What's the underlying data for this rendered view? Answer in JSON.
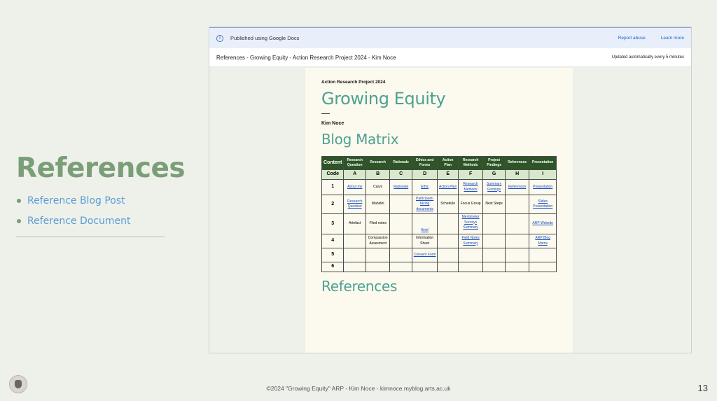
{
  "slide": {
    "title": "References",
    "links": [
      "Reference Blog Post",
      "Reference Document"
    ],
    "footer": "©2024 \"Growing Equity\" ARP - Kim Noce - kimnoce.myblog.arts.ac.uk",
    "page_number": "13"
  },
  "google_bar": {
    "published": "Published using Google Docs",
    "report_abuse": "Report abuse",
    "learn_more": "Learn more"
  },
  "doc_bar": {
    "title": "References - Growing Equity - Action Research Project 2024 - Kim Noce",
    "updated": "Updated automatically every 5 minutes"
  },
  "doc": {
    "project": "Action Research Project 2024",
    "title": "Growing Equity",
    "author": "Kim Noce",
    "matrix_heading": "Blog Matrix",
    "references_heading": "References"
  },
  "matrix": {
    "headers": [
      "Content",
      "Research Question",
      "Research",
      "Rationale",
      "Ethics and Forms",
      "Action Plan",
      "Research Methods",
      "Project Findings",
      "References",
      "Presentation"
    ],
    "codes": [
      "Code",
      "A",
      "B",
      "C",
      "D",
      "E",
      "F",
      "G",
      "H",
      "I"
    ],
    "rows": [
      {
        "num": "1",
        "a": "About me",
        "b": "Carys",
        "c": "Rationale",
        "d": "Ethic",
        "e": "Action Plan",
        "f": "Research Methods",
        "g": "Summary Findings",
        "h": "References",
        "i": "Presentation"
      },
      {
        "num": "2",
        "a": "Research Question",
        "b": "Mahidol",
        "d": "Participant-facing documents",
        "e": "Schedule",
        "f": "Focus Group",
        "g": "Next Steps",
        "i": "Slides Presentation"
      },
      {
        "num": "3",
        "a": "Artefact",
        "b": "Filed notes",
        "d": "Brief",
        "f": "Mentimeter Surveys Summary",
        "i": "ARP Website"
      },
      {
        "num": "4",
        "b": "Compassion Assesment",
        "d": "Information Sheet",
        "f": "Field Notes Summary",
        "i": "ARP Blog Matrix"
      },
      {
        "num": "5",
        "d": "Consent Form"
      },
      {
        "num": "6"
      }
    ]
  }
}
